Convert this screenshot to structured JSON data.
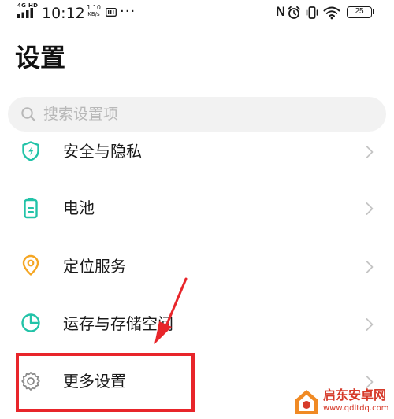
{
  "status_bar": {
    "network_type": "4G HD",
    "time": "10:12",
    "speed_value": "1.10",
    "speed_unit": "KB/s",
    "more": "···",
    "nfc": "N",
    "battery_level": "25"
  },
  "page": {
    "title": "设置"
  },
  "search": {
    "placeholder": "搜索设置项"
  },
  "settings_items": [
    {
      "label": "安全与隐私",
      "icon": "shield-icon",
      "color": "#22c3a8"
    },
    {
      "label": "电池",
      "icon": "battery-icon",
      "color": "#22c3a8"
    },
    {
      "label": "定位服务",
      "icon": "location-pin-icon",
      "color": "#f5a623"
    },
    {
      "label": "运存与存储空间",
      "icon": "storage-pie-icon",
      "color": "#22c3a8"
    },
    {
      "label": "更多设置",
      "icon": "gear-icon",
      "color": "#8a8a8a"
    }
  ],
  "colors": {
    "accent_teal": "#22c3a8",
    "accent_orange": "#f5a623",
    "annotation_red": "#e8252a",
    "watermark_red": "#d63a2a"
  },
  "watermark": {
    "title": "启东安卓网",
    "url": "www.qdltdq.com"
  }
}
